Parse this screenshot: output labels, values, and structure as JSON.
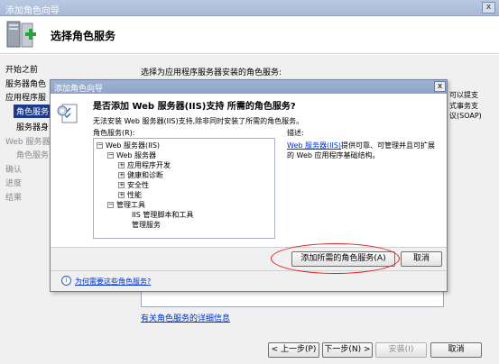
{
  "window": {
    "title": "添加角色向导",
    "close_glyph": "x",
    "header_title": "选择角色服务"
  },
  "nav": {
    "items": [
      {
        "label": "开始之前",
        "state": "normal"
      },
      {
        "label": "服务器角色",
        "state": "normal"
      },
      {
        "label": "应用程序服",
        "state": "normal"
      },
      {
        "label": "角色服务",
        "state": "selected"
      },
      {
        "label": "服务器身",
        "state": "normal"
      },
      {
        "label": "Web 服务器",
        "state": "disabled"
      },
      {
        "label": "角色服务",
        "state": "disabled"
      },
      {
        "label": "确认",
        "state": "disabled"
      },
      {
        "label": "进度",
        "state": "disabled"
      },
      {
        "label": "结果",
        "state": "disabled"
      }
    ]
  },
  "content": {
    "intro": "选择为应用程序服务器安装的角色服务:",
    "desc_line1": "可以提支",
    "desc_line2": "式事务支",
    "desc_line3": "议(SOAP)",
    "more_info_link": "有关角色服务的详细信息"
  },
  "footer": {
    "prev": "< 上一步(P)",
    "next": "下一步(N) >",
    "install": "安装(I)",
    "cancel": "取消"
  },
  "dialog": {
    "title": "添加角色向导",
    "close_glyph": "x",
    "question": "是否添加 Web 服务器(IIS)支持 所需的角色服务?",
    "explain": "无法安装 Web 服务器(IIS)支持,除非同时安装了所需的角色服务。",
    "services_label": "角色服务(R):",
    "tree": [
      {
        "label": "Web 服务器(IIS)",
        "indent": 0,
        "toggle": "−"
      },
      {
        "label": "Web 服务器",
        "indent": 1,
        "toggle": "−"
      },
      {
        "label": "应用程序开发",
        "indent": 2,
        "toggle": "+"
      },
      {
        "label": "健康和诊断",
        "indent": 2,
        "toggle": "+"
      },
      {
        "label": "安全性",
        "indent": 2,
        "toggle": "+"
      },
      {
        "label": "性能",
        "indent": 2,
        "toggle": "+"
      },
      {
        "label": "管理工具",
        "indent": 1,
        "toggle": "−"
      },
      {
        "label": "IIS 管理脚本和工具",
        "indent": 2,
        "toggle": ""
      },
      {
        "label": "管理服务",
        "indent": 2,
        "toggle": ""
      }
    ],
    "desc_label": "描述:",
    "desc_link": "Web 服务器(IIS)",
    "desc_rest": "提供可靠、可管理并且可扩展的 Web 应用程序基础结构。",
    "add_button": "添加所需的角色服务(A)",
    "cancel_button": "取消",
    "help_link": "为何需要这些角色服务?"
  },
  "colors": {
    "selection": "#1e3a8a",
    "link": "#0033cc",
    "highlight": "#e02020"
  }
}
